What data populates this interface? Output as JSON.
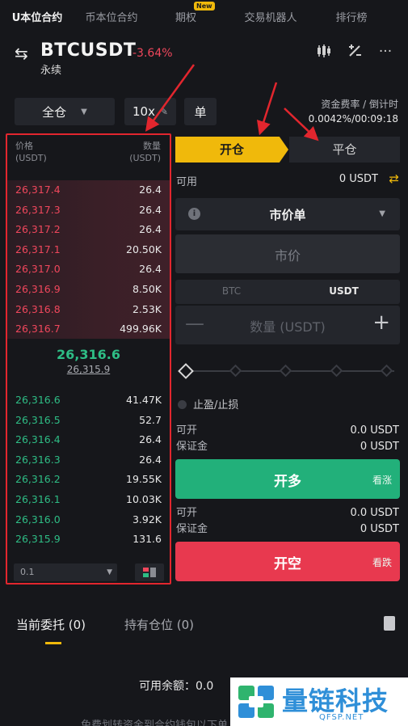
{
  "nav": {
    "tabs": [
      "U本位合约",
      "币本位合约",
      "期权",
      "交易机器人",
      "排行榜"
    ],
    "new_badge": "New"
  },
  "header": {
    "symbol": "BTCUSDT",
    "change": "-3.64%",
    "contract_type": "永续",
    "icons": [
      "candlestick-icon",
      "calculator-icon",
      "more-icon"
    ]
  },
  "controls": {
    "margin_mode": "全仓",
    "leverage": "10x",
    "position_mode": "单",
    "funding_label": "资金费率 / 倒计时",
    "funding_value": "0.0042%/00:09:18"
  },
  "orderbook": {
    "price_header": [
      "价格",
      "(USDT)"
    ],
    "qty_header": [
      "数量",
      "(USDT)"
    ],
    "asks": [
      {
        "price": "26,317.4",
        "qty": "26.4"
      },
      {
        "price": "26,317.3",
        "qty": "26.4"
      },
      {
        "price": "26,317.2",
        "qty": "26.4"
      },
      {
        "price": "26,317.1",
        "qty": "20.50K"
      },
      {
        "price": "26,317.0",
        "qty": "26.4"
      },
      {
        "price": "26,316.9",
        "qty": "8.50K"
      },
      {
        "price": "26,316.8",
        "qty": "2.53K"
      },
      {
        "price": "26,316.7",
        "qty": "499.96K"
      }
    ],
    "last_price": "26,316.6",
    "mark_price": "26,315.9",
    "bids": [
      {
        "price": "26,316.6",
        "qty": "41.47K"
      },
      {
        "price": "26,316.5",
        "qty": "52.7"
      },
      {
        "price": "26,316.4",
        "qty": "26.4"
      },
      {
        "price": "26,316.3",
        "qty": "26.4"
      },
      {
        "price": "26,316.2",
        "qty": "19.55K"
      },
      {
        "price": "26,316.1",
        "qty": "10.03K"
      },
      {
        "price": "26,316.0",
        "qty": "3.92K"
      },
      {
        "price": "26,315.9",
        "qty": "131.6"
      }
    ],
    "precision": "0.1"
  },
  "order": {
    "open_tab": "开仓",
    "close_tab": "平仓",
    "available_label": "可用",
    "available_value": "0 USDT",
    "order_type": "市价单",
    "price_placeholder": "市价",
    "unit_btc": "BTC",
    "unit_usdt": "USDT",
    "qty_placeholder": "数量 (USDT)",
    "tpsl_label": "止盈/止损",
    "long_info": [
      {
        "label": "可开",
        "value": "0.0 USDT"
      },
      {
        "label": "保证金",
        "value": "0 USDT"
      }
    ],
    "long_button": "开多",
    "long_sub": "看涨",
    "short_info": [
      {
        "label": "可开",
        "value": "0.0 USDT"
      },
      {
        "label": "保证金",
        "value": "0 USDT"
      }
    ],
    "short_button": "开空",
    "short_sub": "看跌"
  },
  "bottom": {
    "tab_orders": "当前委托 (0)",
    "tab_positions": "持有仓位 (0)",
    "balance": "可用余额：0.0",
    "footnote": "免费划转资金到合约钱包以下单"
  },
  "watermark": {
    "name": "量链科技",
    "url": "QFSP.NET"
  },
  "colors": {
    "accent": "#f0b90b",
    "buy": "#2ebd85",
    "sell": "#f0475c",
    "highlight_border": "#e2262e"
  }
}
